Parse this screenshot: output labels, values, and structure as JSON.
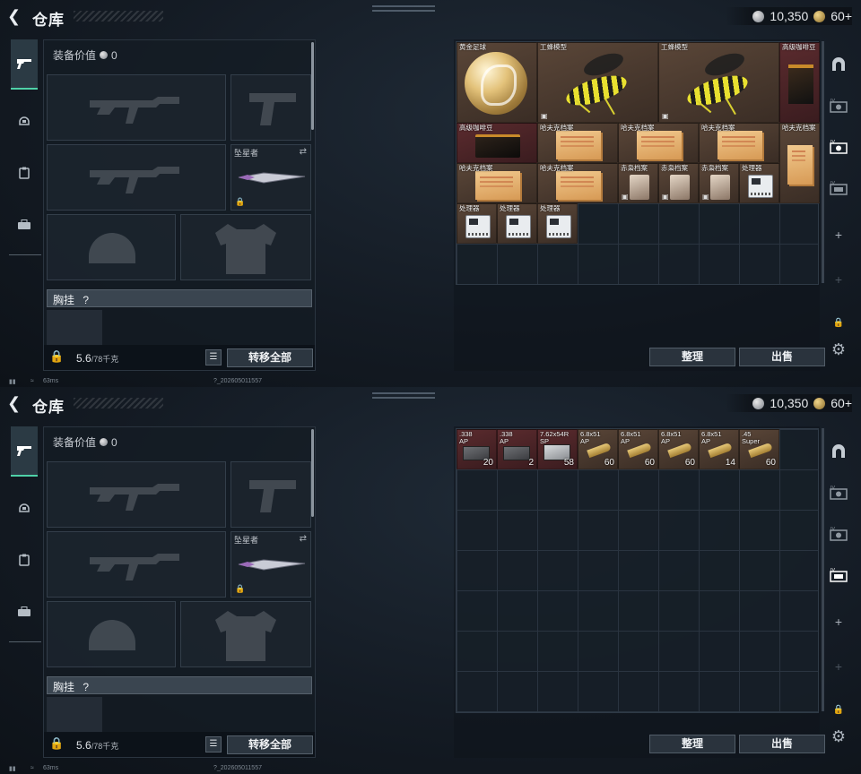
{
  "header": {
    "title": "仓库",
    "silver": "10,350",
    "gold": "60+"
  },
  "equipment": {
    "value_label": "装备价值",
    "value": "0",
    "melee_label": "坠星者",
    "chest_label": "胸挂",
    "chest_help": "?",
    "weight": "5.6",
    "weight_max": "/78千克",
    "transfer_all": "转移全部"
  },
  "status": {
    "ping": "63ms",
    "build": "?_202605011557"
  },
  "stash": {
    "sort": "整理",
    "sell": "出售"
  },
  "screen1_items": [
    {
      "name": "黄金足球"
    },
    {
      "name": "工蜂模型"
    },
    {
      "name": "工蜂模型"
    },
    {
      "name": "高级咖啡豆"
    },
    {
      "name": "高级咖啡豆"
    },
    {
      "name": "哈夫克档案"
    },
    {
      "name": "哈夫克档案"
    },
    {
      "name": "哈夫克档案"
    },
    {
      "name": "哈夫克档案"
    },
    {
      "name": "哈夫克档案"
    },
    {
      "name": "哈夫克档案"
    },
    {
      "name": "赤枭档案"
    },
    {
      "name": "赤枭档案"
    },
    {
      "name": "赤枭档案"
    },
    {
      "name": "处理器"
    },
    {
      "name": "处理器"
    },
    {
      "name": "处理器"
    },
    {
      "name": "处理器"
    }
  ],
  "screen2_items": [
    {
      "name": ".338\nAP",
      "count": "20"
    },
    {
      "name": ".338\nAP",
      "count": "2"
    },
    {
      "name": "7.62x54R\nSP",
      "count": "58"
    },
    {
      "name": "6.8x51\nAP",
      "count": "60"
    },
    {
      "name": "6.8x51\nAP",
      "count": "60"
    },
    {
      "name": "6.8x51\nAP",
      "count": "60"
    },
    {
      "name": "6.8x51\nAP",
      "count": "14"
    },
    {
      "name": ".45\nSuper",
      "count": "60"
    }
  ]
}
